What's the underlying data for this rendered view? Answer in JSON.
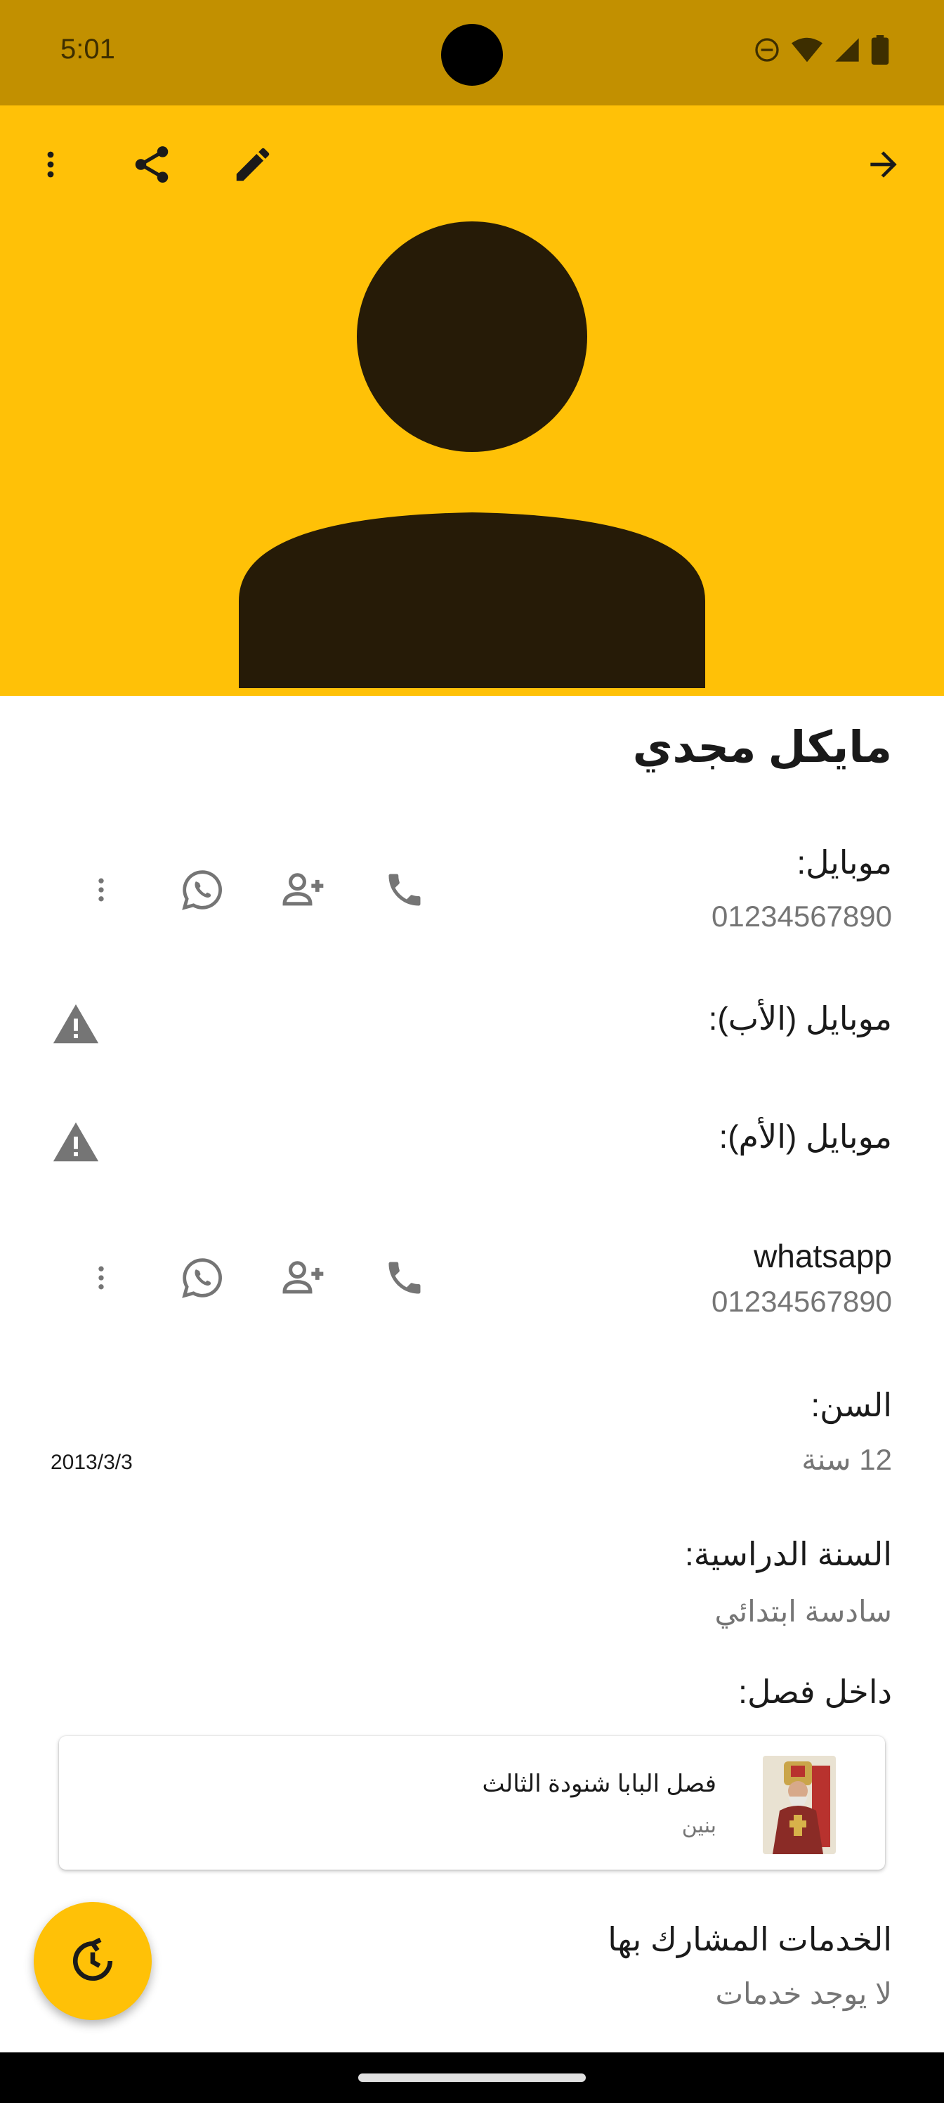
{
  "status_bar": {
    "time": "5:01"
  },
  "toolbar": {
    "icons": [
      "more-vert-icon",
      "share-icon",
      "edit-icon",
      "arrow-forward-icon"
    ]
  },
  "profile": {
    "name": "مايكل مجدي"
  },
  "fields": {
    "mobile": {
      "label": "موبايل:",
      "value": "01234567890"
    },
    "father_mobile": {
      "label": "موبايل (الأب):"
    },
    "mother_mobile": {
      "label": "موبايل (الأم):"
    },
    "whatsapp": {
      "label": "whatsapp",
      "value": "01234567890"
    },
    "age": {
      "label": "السن:",
      "value": "12 سنة",
      "birth_date": "2013/3/3"
    },
    "school_year": {
      "label": "السنة الدراسية:",
      "value": "سادسة ابتدائي"
    },
    "class": {
      "label": "داخل فصل:",
      "card_title": "فصل البابا شنودة الثالث",
      "card_subtitle": "بنين"
    },
    "services": {
      "label": "الخدمات المشارك بها",
      "value": "لا يوجد خدمات"
    }
  },
  "colors": {
    "accent": "#FFC107",
    "status_bar": "#C29000",
    "avatar": "#261B07",
    "secondary_text": "#757575"
  }
}
